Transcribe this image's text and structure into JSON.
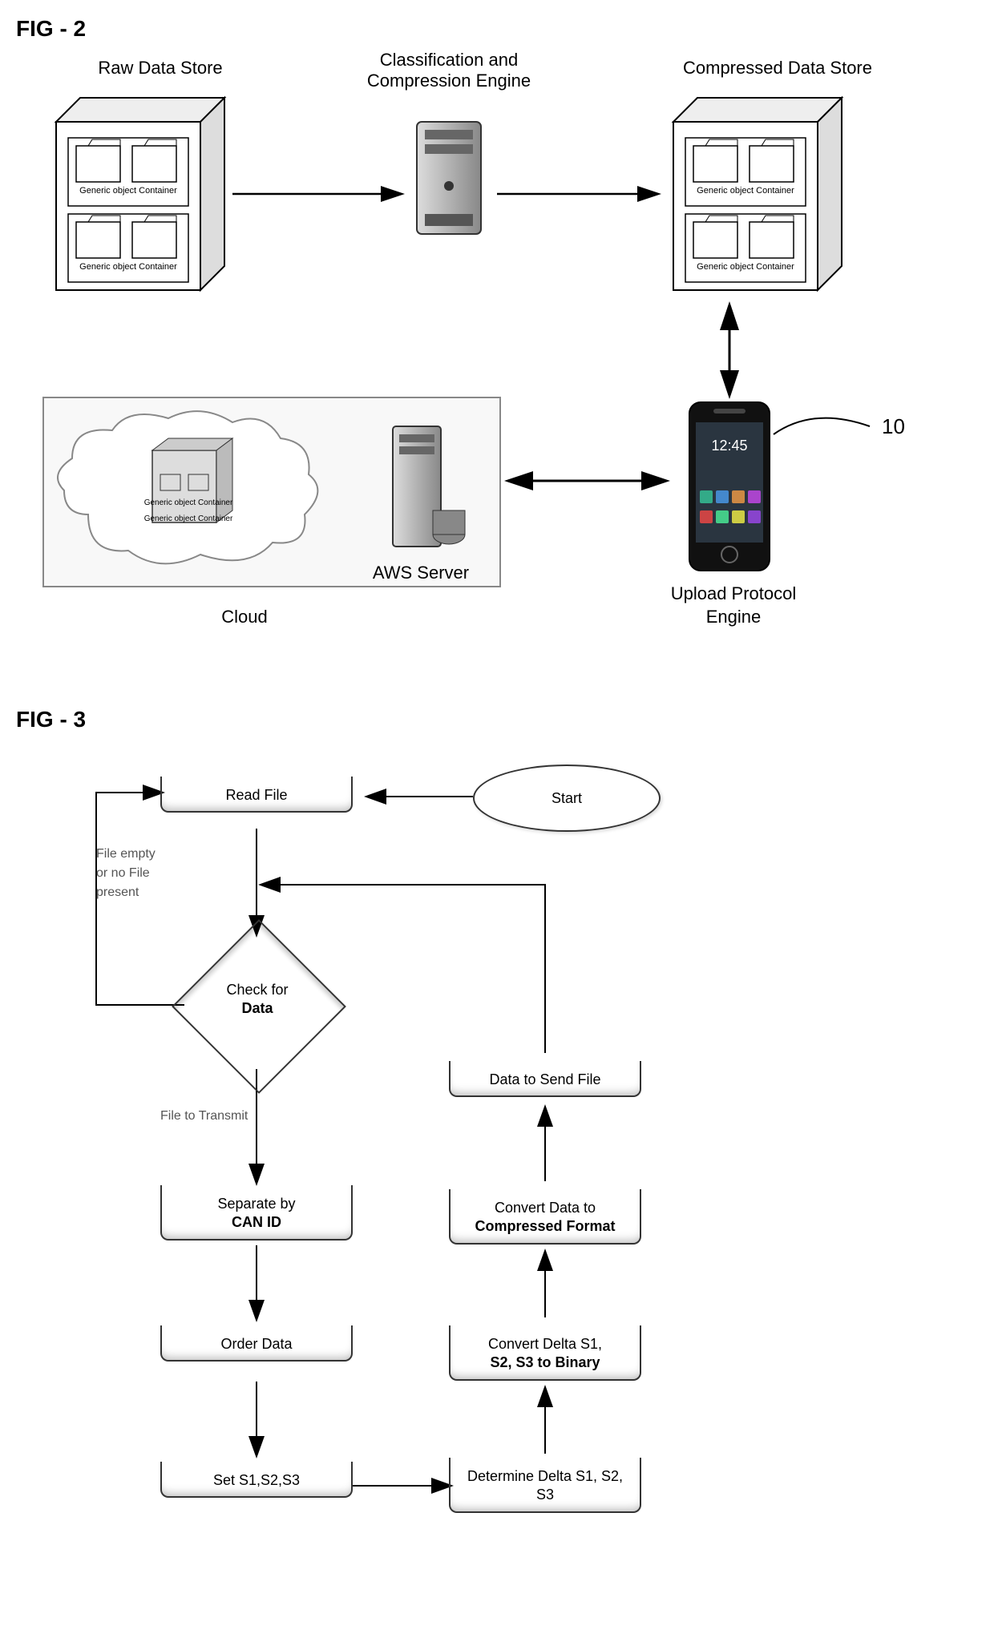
{
  "fig2": {
    "title": "FIG - 2",
    "rawDataStore": "Raw Data Store",
    "classEngine": "Classification and Compression Engine",
    "compressedStore": "Compressed Data Store",
    "awsServer": "AWS Server",
    "cloud": "Cloud",
    "uploadEngine": "Upload Protocol Engine",
    "containerLabel": "Generic object Container",
    "calloutNum": "10"
  },
  "fig3": {
    "title": "FIG - 3",
    "start": "Start",
    "readFile": "Read File",
    "checkData": "Check for",
    "checkDataBold": "Data",
    "emptyNote": "File empty or no File present",
    "fileTransmit": "File to Transmit",
    "separate": "Separate by",
    "separateBold": "CAN ID",
    "orderData": "Order Data",
    "setS": "Set S1,S2,S3",
    "determineDelta": "Determine Delta S1, S2, S3",
    "convertDelta1": "Convert Delta S1,",
    "convertDelta2": "S2, S3 to Binary",
    "convertComp1": "Convert Data to",
    "convertComp2": "Compressed Format",
    "dataSend": "Data to Send File"
  }
}
